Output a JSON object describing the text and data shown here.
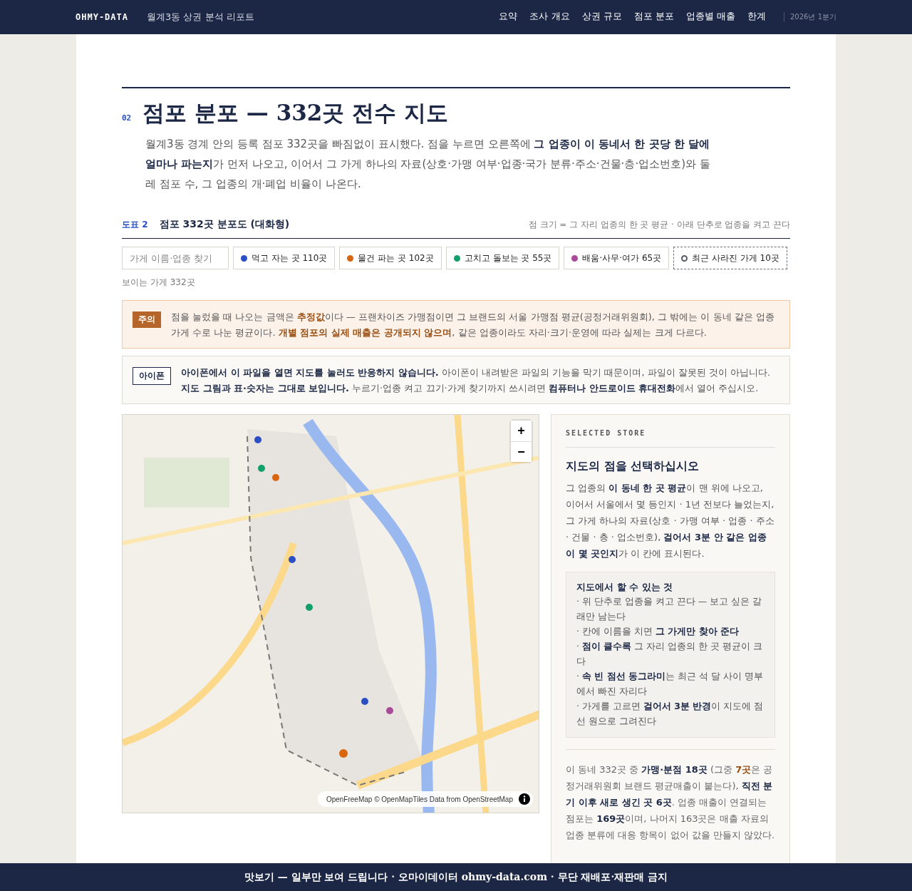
{
  "topbar": {
    "brand": "OHMY-DATA",
    "report_title": "월계3동 상권 분석 리포트",
    "nav": [
      {
        "label": "요약",
        "selected": false
      },
      {
        "label": "조사 개요",
        "selected": false
      },
      {
        "label": "상권 규모",
        "selected": false
      },
      {
        "label": "점포 분포",
        "selected": false
      },
      {
        "label": "업종별 매출",
        "selected": false
      },
      {
        "label": "한계",
        "selected": false
      }
    ],
    "period": "2026년 1분기"
  },
  "section": {
    "number": "02",
    "title": "점포 분포 — 332곳 전수 지도",
    "lead": "월계3동 경계 안의 등록 점포 332곳을 빠짐없이 표시했다. 점을 누르면 오른쪽에 **그 업종이 이 동네서 한 곳당 한 달에 얼마나 파는지**가 먼저 나오고, 이어서 그 가게 하나의 자료(상호·가맹 여부·업종·국가 분류·주소·건물·층·업소번호)와 둘레 점포 수, 그 업종의 개·폐업 비율이 나온다."
  },
  "figure": {
    "label": "도표 2",
    "title": "점포 332곳 분포도 (대화형)",
    "note": "점 크기 = 그 자리 업종의 한 곳 평균 · 아래 단추로 업종을 켜고 끈다",
    "search": {
      "placeholder": "가게 이름·업종 찾기"
    },
    "filters": [
      {
        "kind": "dot",
        "label": "먹고 자는 곳 110곳",
        "color": "#2a4fc4",
        "on": true
      },
      {
        "kind": "dot",
        "label": "물건 파는 곳 102곳",
        "color": "#d9650f",
        "on": true
      },
      {
        "kind": "dot",
        "label": "고치고 돌보는 곳 55곳",
        "color": "#11a06a",
        "on": true
      },
      {
        "kind": "dot",
        "label": "배움·사무·여가 65곳",
        "color": "#a84a98",
        "on": true
      },
      {
        "kind": "ring",
        "label": "최근 사라진 가게 10곳",
        "color": "#555a66",
        "on": true
      }
    ],
    "visible_count": "보이는 가게 332곳"
  },
  "notices": [
    {
      "kind": "caution",
      "badge": "주의",
      "text": "점을 눌렀을 때 나오는 금액은 **추정값**이다 — 프랜차이즈 가맹점이면 그 브랜드의 서울 가맹점 평균(공정거래위원회), 그 밖에는 이 동네 같은 업종 가게 수로 나눈 평균이다. **개별 점포의 실제 매출은 공개되지 않으며**, 같은 업종이라도 자리·크기·운영에 따라 실제는 크게 다르다."
    },
    {
      "kind": "info",
      "badge": "아이폰",
      "text": "**아이폰에서 이 파일을 열면 지도를 눌러도 반응하지 않습니다.** 아이폰이 내려받은 파일의 기능을 막기 때문이며, 파일이 잘못된 것이 아닙니다. **지도 그림과 표·숫자는 그대로 보입니다.** 누르기·업종 켜고 끄기·가게 찾기까지 쓰시려면 **컴퓨터나 안드로이드 휴대전화**에서 열어 주십시오."
    }
  ],
  "map": {
    "kind": "picture",
    "zoom_in": "+",
    "zoom_out": "−",
    "attribution": "OpenFreeMap © OpenMapTiles Data from OpenStreetMap"
  },
  "panel": {
    "eyebrow": "SELECTED STORE",
    "title": "지도의 점을 선택하십시오",
    "body": "그 업종의 **이 동네 한 곳 평균**이 맨 위에 나오고, 이어서 서울에서 몇 등인지 · 1년 전보다 늘었는지, 그 가게 하나의 자료(상호 · 가맹 여부 · 업종 · 주소 · 건물 · 층 · 업소번호), **걸어서 3분 안 같은 업종이 몇 곳인지**가 이 칸에 표시된다.",
    "help_title": "지도에서 할 수 있는 것",
    "help_items": [
      "· 위 단추로 업종을 켜고 끈다 — 보고 싶은 갈래만 남는다",
      "· 칸에 이름을 치면 **그 가게만 찾아 준다**",
      "· **점이 클수록** 그 자리 업종의 한 곳 평균이 크다",
      "· **속 빈 점선 동그라미**는 최근 석 달 사이 명부에서 빠진 자리다",
      "· 가게를 고르면 **걸어서 3분 반경**이 지도에 점선 원으로 그려진다"
    ],
    "summary": "이 동네 332곳 중 **가맹·분점 18곳** (그중 **7곳**은 공정거래위원회 브랜드 평균매출이 붙는다), **직전 분기 이후 새로 생긴 곳 6곳**. 업종 매출이 연결되는 점포는 **169곳**이며, 나머지 163곳은 매출 자료의 업종 분류에 대응 항목이 없어 값을 만들지 않았다."
  },
  "footer": "맛보기 — 일부만 보여 드립니다 · 오마이데이터 ohmy-data.com · 무단 재배포·재판매 금지"
}
